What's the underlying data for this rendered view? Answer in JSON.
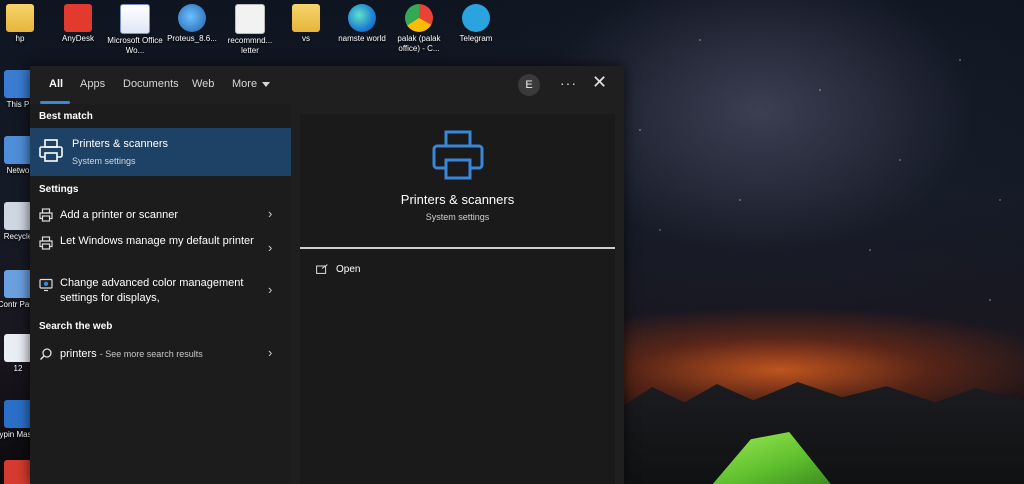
{
  "desktop": {
    "top_icons": [
      {
        "label": "hp",
        "icon": "folder-icon"
      },
      {
        "label": "AnyDesk",
        "icon": "anydesk-icon"
      },
      {
        "label": "Microsoft Office Wo...",
        "icon": "word-icon"
      },
      {
        "label": "Proteus_8.6...",
        "icon": "proteus-icon"
      },
      {
        "label": "recommnd... letter",
        "icon": "document-icon"
      },
      {
        "label": "vs",
        "icon": "folder-icon"
      },
      {
        "label": "namste world",
        "icon": "edge-icon"
      },
      {
        "label": "palak (palak office) - C...",
        "icon": "chrome-icon"
      },
      {
        "label": "Telegram",
        "icon": "telegram-icon"
      }
    ],
    "left_icons": [
      {
        "label": "This P",
        "icon": "this-pc-icon"
      },
      {
        "label": "Netwo",
        "icon": "network-icon"
      },
      {
        "label": "Recycle",
        "icon": "recycle-bin-icon"
      },
      {
        "label": "Contr Pane",
        "icon": "control-panel-icon"
      },
      {
        "label": "12",
        "icon": "file-icon"
      },
      {
        "label": "Typin Master",
        "icon": "typing-master-icon"
      },
      {
        "label": "",
        "icon": "pdf-icon"
      }
    ]
  },
  "search": {
    "tabs": [
      {
        "label": "All",
        "active": true
      },
      {
        "label": "Apps"
      },
      {
        "label": "Documents"
      },
      {
        "label": "Web"
      },
      {
        "label": "More"
      }
    ],
    "avatar_initial": "E",
    "more_glyph": "···",
    "close_glyph": "✕",
    "sections": {
      "best_match": "Best match",
      "settings": "Settings",
      "web": "Search the web"
    },
    "best_match": {
      "title": "Printers & scanners",
      "subtitle": "System settings"
    },
    "settings_items": [
      {
        "label": "Add a printer or scanner"
      },
      {
        "label": "Let Windows manage my default printer"
      },
      {
        "label": "Change advanced color management settings for displays,"
      }
    ],
    "web_item": {
      "query": "printers",
      "suffix": "- See more search results"
    },
    "chevron": "›",
    "preview": {
      "title": "Printers & scanners",
      "subtitle": "System settings",
      "open_label": "Open"
    },
    "colors": {
      "accent": "#3a86d8",
      "selected_bg": "#1e4266"
    }
  }
}
